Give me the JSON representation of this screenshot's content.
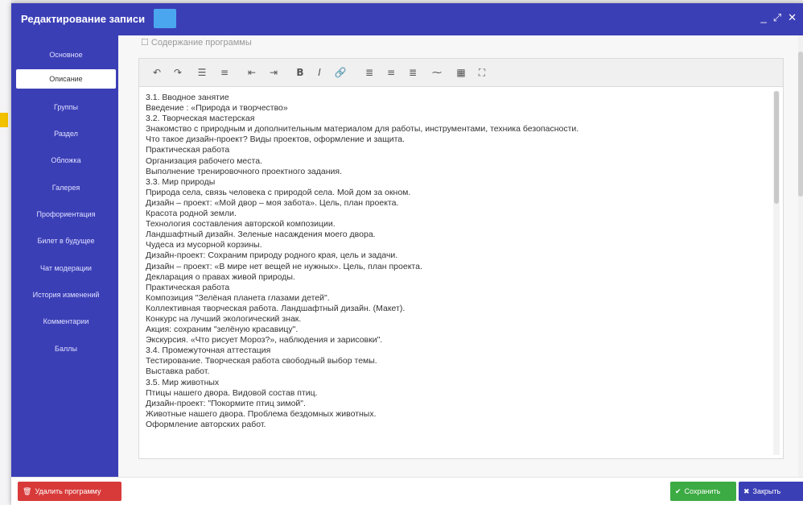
{
  "dialog": {
    "title": "Редактирование записи",
    "controls": [
      "_",
      "⤢",
      "✕"
    ]
  },
  "sidebar": {
    "items": [
      {
        "label": "Основное"
      },
      {
        "label": "Описание"
      },
      {
        "label": "Группы"
      },
      {
        "label": "Раздел"
      },
      {
        "label": "Обложка"
      },
      {
        "label": "Галерея"
      },
      {
        "label": "Профориентация"
      },
      {
        "label": "Билет в будущее"
      },
      {
        "label": "Чат модерации"
      },
      {
        "label": "История изменений"
      },
      {
        "label": "Комментарии"
      },
      {
        "label": "Баллы"
      }
    ]
  },
  "section": {
    "label": "☐ Содержание программы"
  },
  "toolbar": {
    "buttons": [
      {
        "icon": "undo-icon",
        "glyph": "↶"
      },
      {
        "icon": "redo-icon",
        "glyph": "↷"
      },
      {
        "icon": "bulleted-list-icon",
        "glyph": "☰"
      },
      {
        "icon": "numbered-list-icon",
        "glyph": "≡"
      },
      {
        "icon": "outdent-icon",
        "glyph": "⇤"
      },
      {
        "icon": "indent-icon",
        "glyph": "⇥"
      },
      {
        "icon": "bold-icon",
        "glyph": "B"
      },
      {
        "icon": "italic-icon",
        "glyph": "I"
      },
      {
        "icon": "link-icon",
        "glyph": "🔗"
      },
      {
        "icon": "align-left-icon",
        "glyph": "≣"
      },
      {
        "icon": "align-center-icon",
        "glyph": "≡"
      },
      {
        "icon": "align-right-icon",
        "glyph": "≣"
      },
      {
        "icon": "unlink-icon",
        "glyph": "⁓"
      },
      {
        "icon": "table-icon",
        "glyph": "▦"
      },
      {
        "icon": "fullscreen-icon",
        "glyph": "⛶"
      }
    ]
  },
  "editor_lines": [
    "3.1. Вводное занятие",
    "Введение : «Природа и творчество»",
    "3.2. Творческая мастерская",
    "Знакомство с природным и дополнительным материалом для работы, инструментами, техника безопасности.",
    "Что такое дизайн-проект? Виды проектов, оформление и защита.",
    "Практическая работа",
    "Организация рабочего места.",
    "Выполнение тренировочного проектного задания.",
    "3.3. Мир природы",
    "Природа села, связь человека с природой села. Мой дом за окном.",
    "Дизайн – проект: «Мой двор – моя забота». Цель, план проекта.",
    "Красота родной земли.",
    "Технология составления авторской композиции.",
    "Ландшафтный дизайн. Зеленые насаждения моего двора.",
    "Чудеса из мусорной корзины.",
    "Дизайн-проект: Сохраним природу родного края, цель и задачи.",
    "Дизайн – проект: «В мире нет вещей не нужных». Цель, план проекта.",
    "Декларация о правах живой природы.",
    "Практическая работа",
    "Композиция \"Зелёная планета глазами детей\".",
    "Коллективная творческая работа. Ландшафтный дизайн. (Макет).",
    "Конкурс на лучший экологический знак.",
    "Акция: сохраним \"зелёную красавицу\".",
    "Экскурсия. «Что рисует Мороз?», наблюдения и зарисовки\".",
    "3.4. Промежуточная аттестация",
    "Тестирование. Творческая работа свободный выбор темы.",
    "Выставка работ.",
    "3.5. Мир животных",
    "Птицы нашего двора. Видовой состав птиц.",
    "Дизайн-проект: \"Покормите птиц зимой\".",
    "Животные нашего двора. Проблема бездомных животных.",
    "Оформление авторских работ."
  ],
  "footer": {
    "delete_label": "Удалить программу",
    "save_label": "Сохранить",
    "close_label": "Закрыть"
  },
  "colors": {
    "accent": "#3b3fb6",
    "save": "#3cab43",
    "delete": "#d83a3a",
    "title_chip": "#4aa7ef"
  }
}
